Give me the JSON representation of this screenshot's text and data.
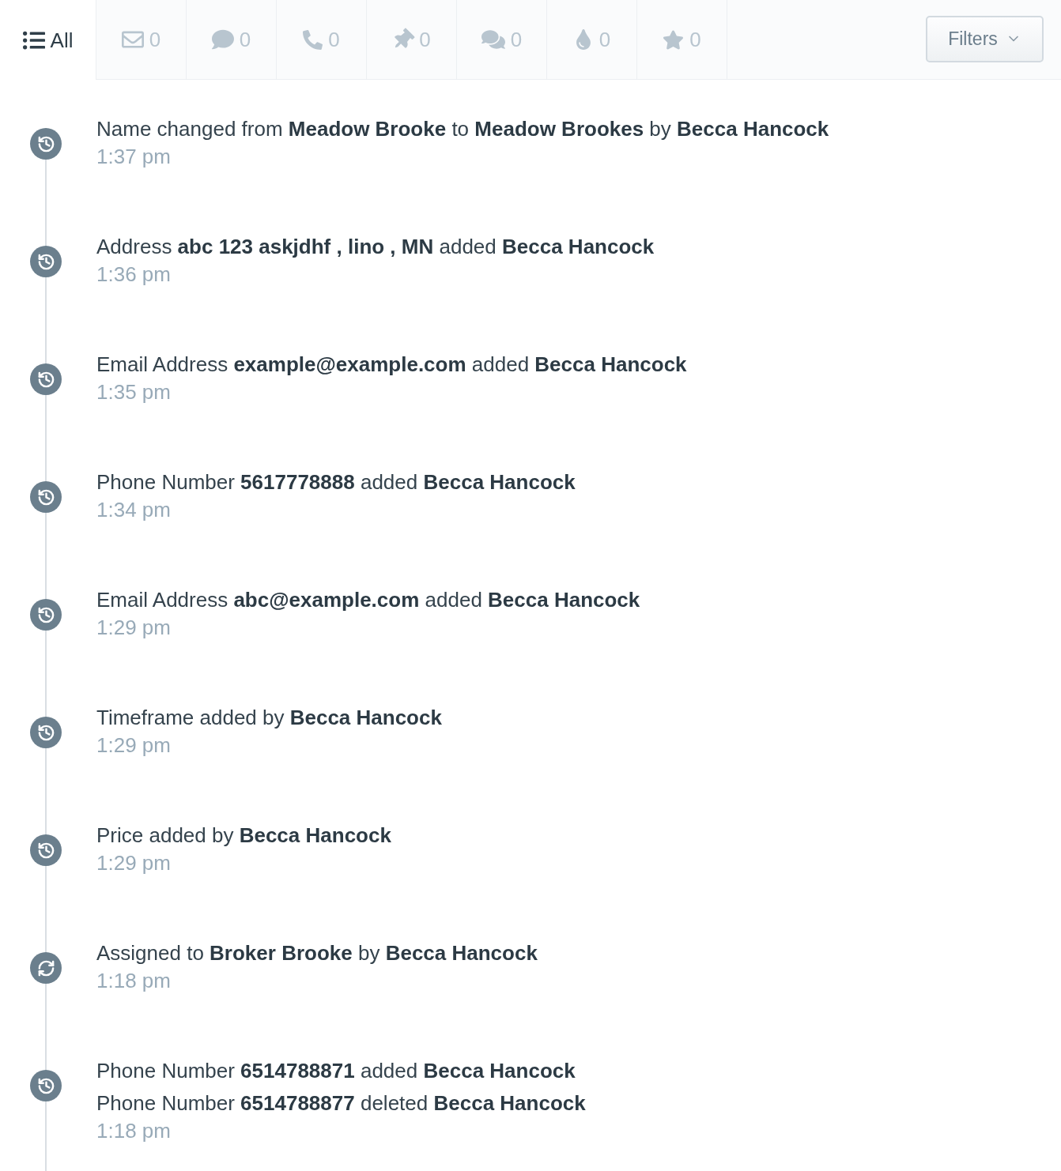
{
  "tabs": [
    {
      "kind": "all",
      "label": "All",
      "selected": true
    },
    {
      "kind": "email",
      "count": "0",
      "selected": false
    },
    {
      "kind": "message",
      "count": "0",
      "selected": false
    },
    {
      "kind": "call",
      "count": "0",
      "selected": false
    },
    {
      "kind": "note",
      "count": "0",
      "selected": false
    },
    {
      "kind": "chat",
      "count": "0",
      "selected": false
    },
    {
      "kind": "drip",
      "count": "0",
      "selected": false
    },
    {
      "kind": "favorite",
      "count": "0",
      "selected": false
    }
  ],
  "filters_button": {
    "label": "Filters"
  },
  "activities": [
    {
      "kind": "history",
      "lines": [
        "Name changed from **Meadow Brooke** to **Meadow Brookes** by **Becca Hancock**"
      ],
      "time": "1:37 pm"
    },
    {
      "kind": "history",
      "lines": [
        "Address **abc 123 askjdhf , lino , MN** added **Becca Hancock**"
      ],
      "time": "1:36 pm"
    },
    {
      "kind": "history",
      "lines": [
        "Email Address **example@example.com** added **Becca Hancock**"
      ],
      "time": "1:35 pm"
    },
    {
      "kind": "history",
      "lines": [
        "Phone Number **5617778888** added **Becca Hancock**"
      ],
      "time": "1:34 pm"
    },
    {
      "kind": "history",
      "lines": [
        "Email Address **abc@example.com** added **Becca Hancock**"
      ],
      "time": "1:29 pm"
    },
    {
      "kind": "history",
      "lines": [
        "Timeframe added by **Becca Hancock**"
      ],
      "time": "1:29 pm"
    },
    {
      "kind": "history",
      "lines": [
        "Price added by **Becca Hancock**"
      ],
      "time": "1:29 pm"
    },
    {
      "kind": "assignment",
      "lines": [
        "Assigned to **Broker Brooke** by **Becca Hancock**"
      ],
      "time": "1:18 pm"
    },
    {
      "kind": "history",
      "lines": [
        "Phone Number **6514788871** added **Becca Hancock**",
        "Phone Number **6514788877** deleted **Becca Hancock**"
      ],
      "time": "1:18 pm"
    }
  ]
}
